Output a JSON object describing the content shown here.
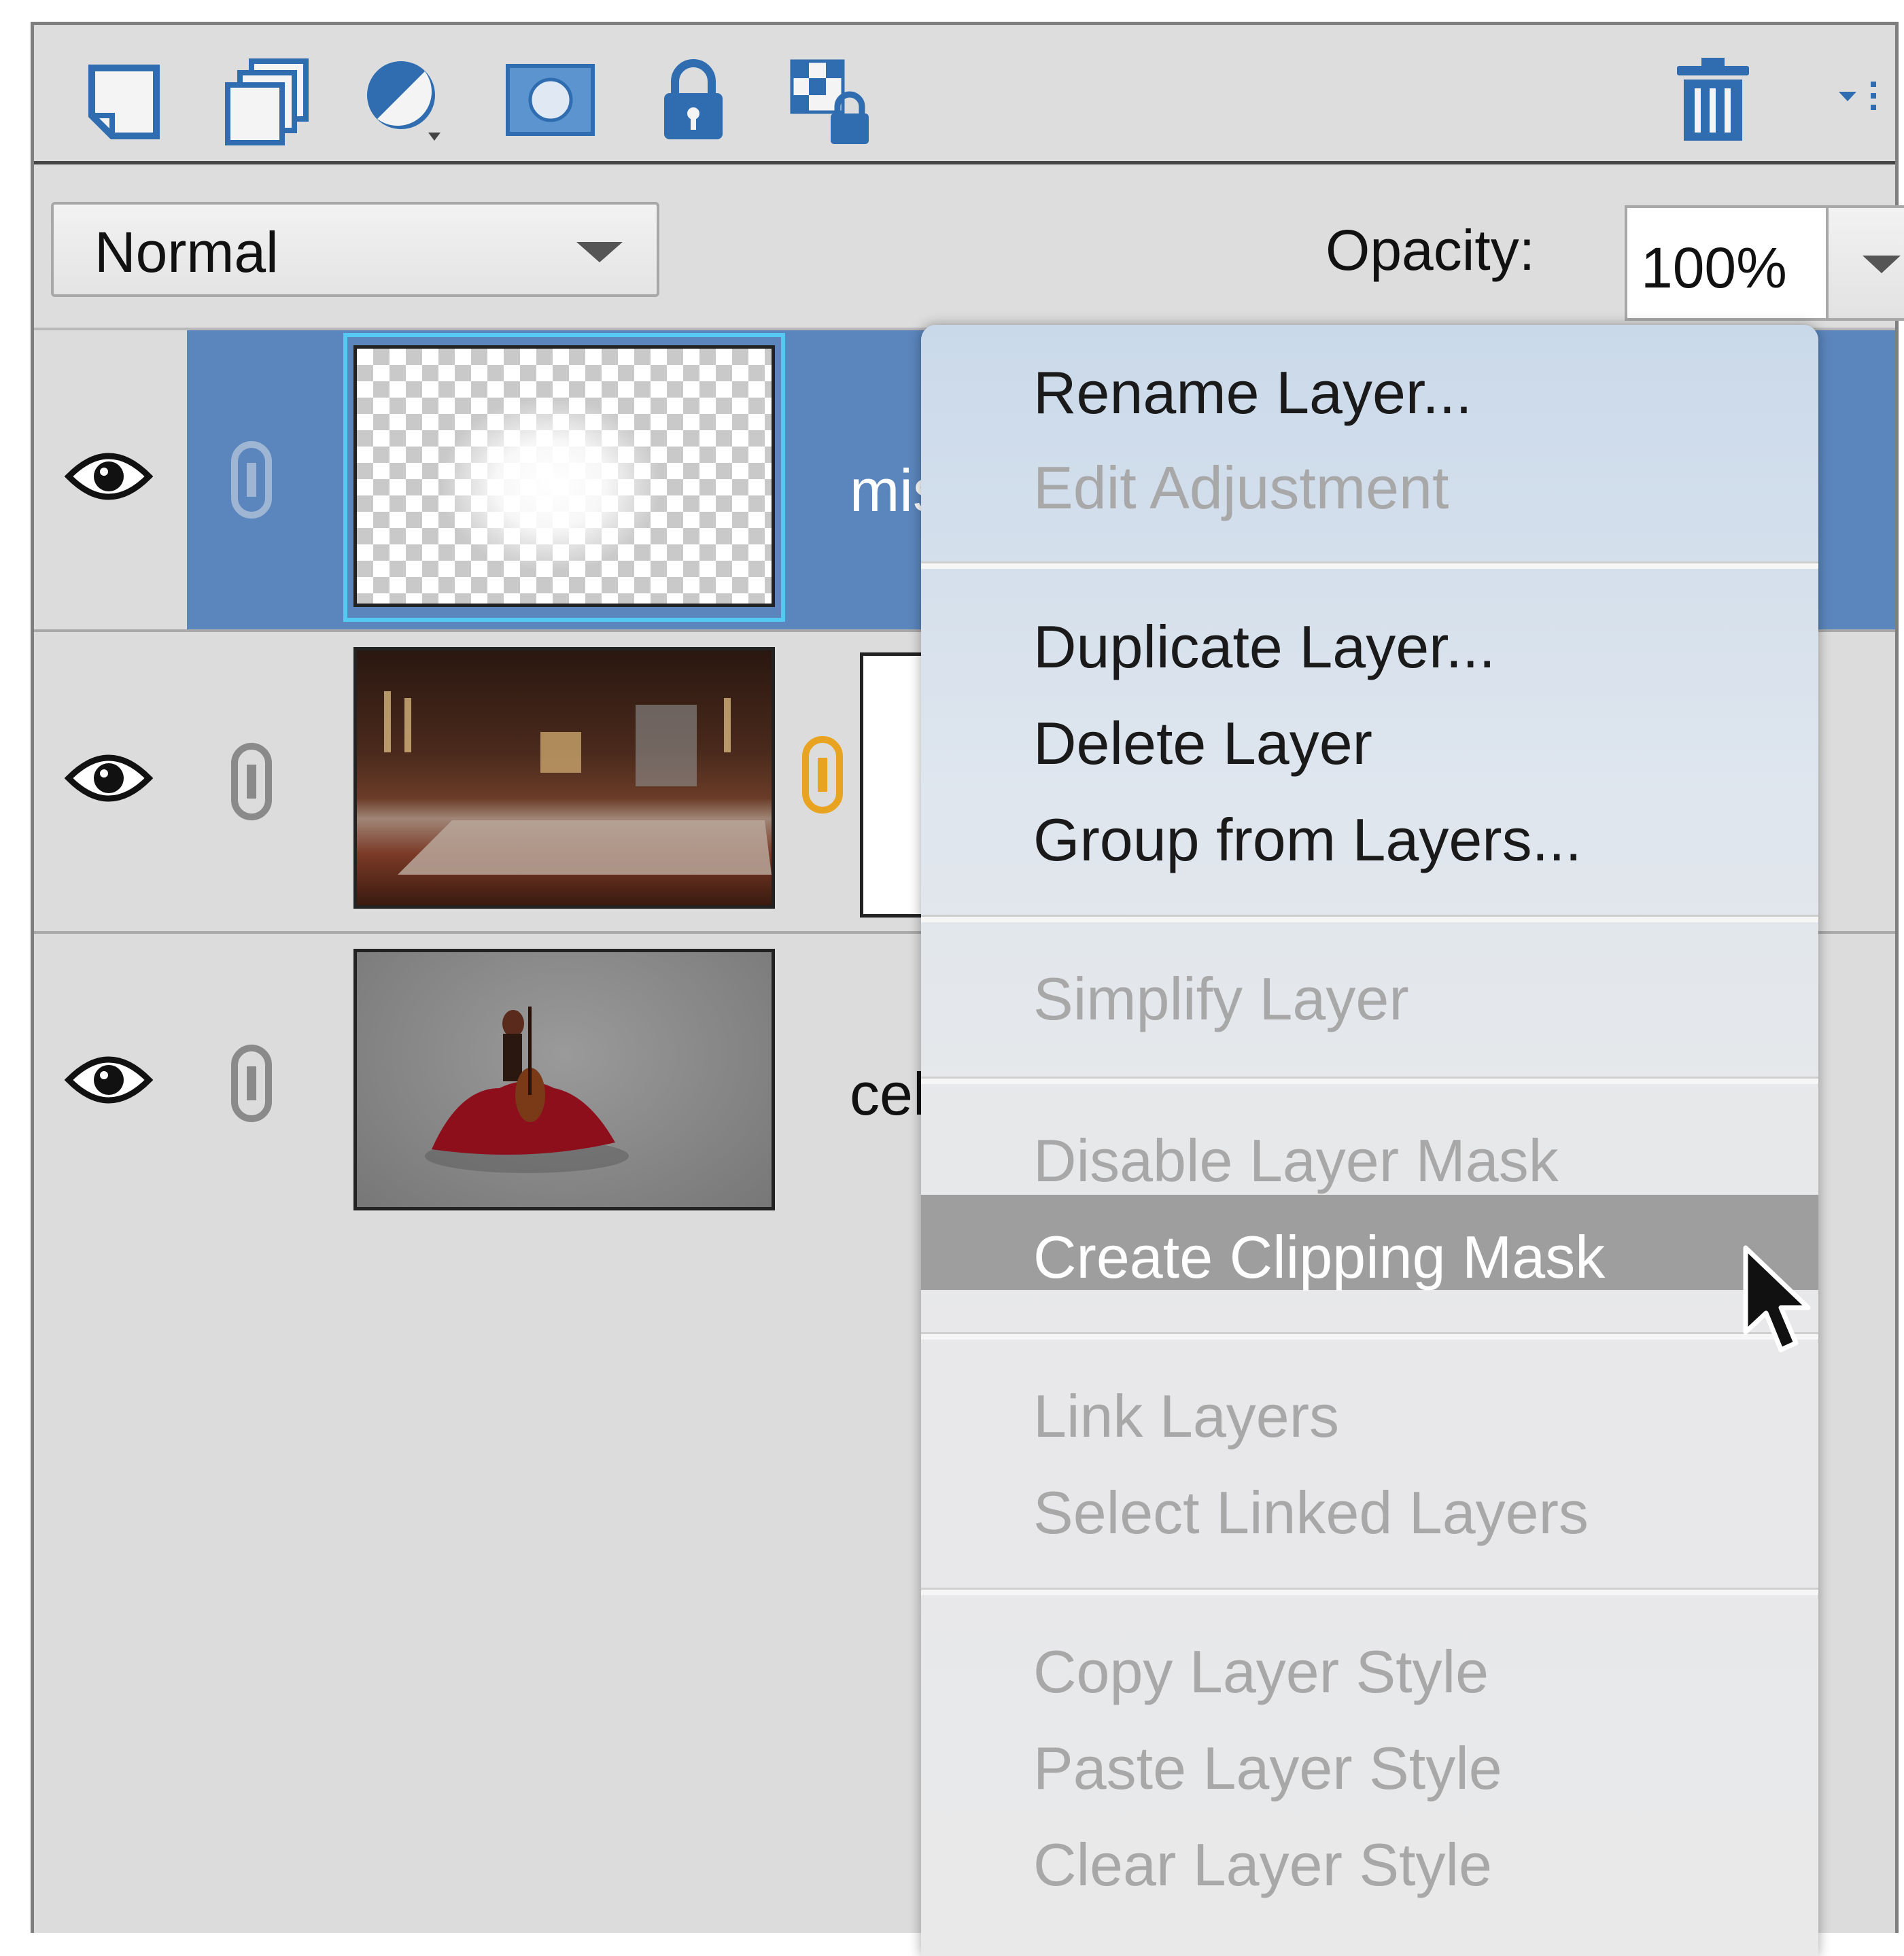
{
  "toolbar": {
    "icons": [
      "new-layer-icon",
      "new-group-icon",
      "adjustment-layer-icon",
      "layer-mask-icon",
      "lock-all-icon",
      "lock-transparent-icon",
      "trash-icon",
      "panel-menu-icon"
    ]
  },
  "blend": {
    "mode": "Normal"
  },
  "opacity": {
    "label": "Opacity:",
    "value": "100%"
  },
  "layers": [
    {
      "name_partial": "mis",
      "selected": true
    },
    {
      "name_partial": "",
      "selected": false
    },
    {
      "name_partial": "cel",
      "selected": false
    }
  ],
  "menu": {
    "rename": "Rename Layer...",
    "edit_adjustment": "Edit Adjustment",
    "duplicate": "Duplicate Layer...",
    "delete": "Delete Layer",
    "group": "Group from Layers...",
    "simplify": "Simplify Layer",
    "disable_mask": "Disable Layer Mask",
    "create_clipping": "Create Clipping Mask",
    "link": "Link Layers",
    "select_linked": "Select Linked Layers",
    "copy_style": "Copy Layer Style",
    "paste_style": "Paste Layer Style",
    "clear_style": "Clear Layer Style"
  },
  "colors": {
    "selection": "#5b86bd",
    "panel": "#dcdcdc",
    "highlight": "#9e9e9e",
    "icon_blue": "#2f6db0"
  }
}
